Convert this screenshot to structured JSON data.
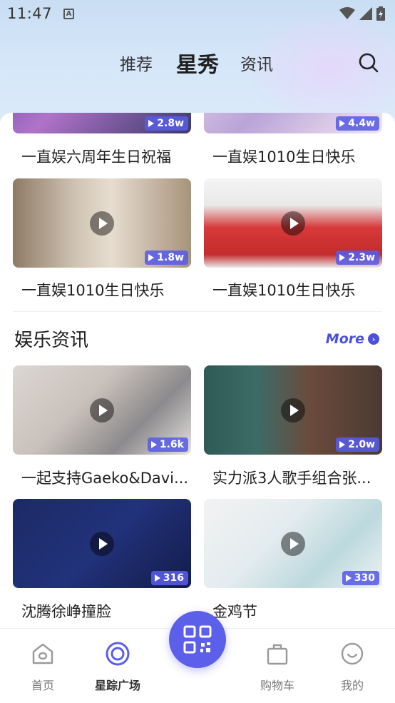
{
  "status_bar": {
    "time": "11:47",
    "notif_icon": "A"
  },
  "header": {
    "tabs": [
      {
        "label": "推荐"
      },
      {
        "label": "星秀"
      },
      {
        "label": "资讯"
      }
    ],
    "active_tab": "星秀"
  },
  "videos": [
    {
      "title": "一直娱六周年生日祝福",
      "views": "2.8w"
    },
    {
      "title": "一直娱1010生日快乐",
      "views": "4.4w"
    },
    {
      "title": "一直娱1010生日快乐",
      "views": "1.8w"
    },
    {
      "title": "一直娱1010生日快乐",
      "views": "2.3w"
    }
  ],
  "news_section": {
    "title": "娱乐资讯",
    "more_label": "More",
    "items": [
      {
        "title": "一起支持Gaeko&Davi...",
        "views": "1.6k"
      },
      {
        "title": "实力派3人歌手组合张...",
        "views": "2.0w"
      },
      {
        "title": "沈腾徐峥撞脸",
        "views": "316"
      },
      {
        "title": "金鸡节",
        "views": "330"
      }
    ]
  },
  "bottom_nav": {
    "items": [
      {
        "label": "首页",
        "icon": "home-icon"
      },
      {
        "label": "星踪广场",
        "icon": "target-icon"
      },
      {
        "label": "购物车",
        "icon": "bag-icon"
      },
      {
        "label": "我的",
        "icon": "smile-icon"
      }
    ],
    "center_icon": "qr-code-icon"
  },
  "colors": {
    "accent": "#5b5fe9",
    "badge": "#585ce6"
  }
}
